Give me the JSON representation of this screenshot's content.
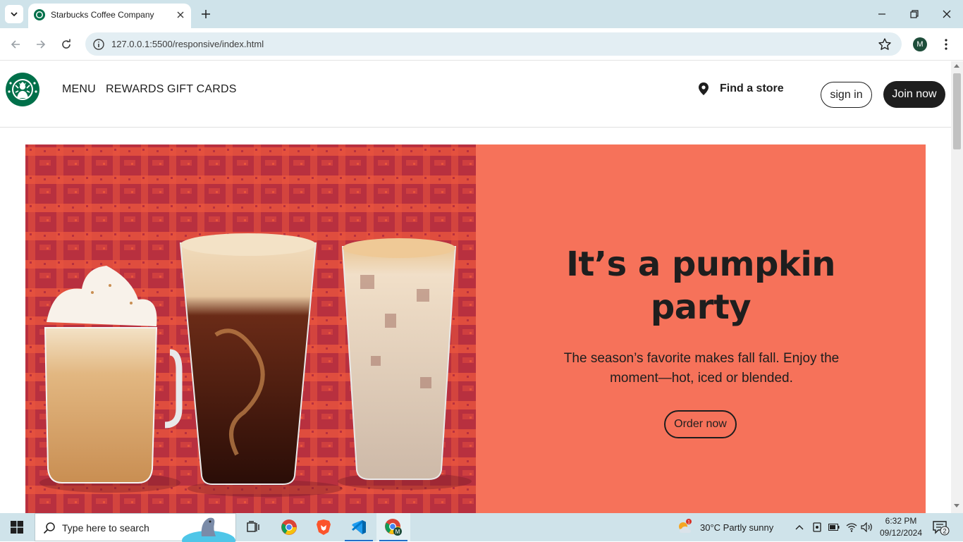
{
  "browser": {
    "tab_title": "Starbucks Coffee Company",
    "url": "127.0.0.1:5500/responsive/index.html",
    "profile_initial": "M"
  },
  "site": {
    "nav": [
      "MENU",
      "REWARDS",
      "GIFT CARDS"
    ],
    "find_store": "Find a store",
    "sign_in": "sign in",
    "join_now": "Join now"
  },
  "hero": {
    "title_line1": "It’s a pumpkin",
    "title_line2": "party",
    "subtitle": "The season’s favorite makes fall fall. Enjoy the moment—hot, iced or blended.",
    "cta": "Order now",
    "background_color": "#f6725a"
  },
  "taskbar": {
    "search_placeholder": "Type here to search",
    "weather": "30°C  Partly sunny",
    "time": "6:32 PM",
    "date": "09/12/2024",
    "notification_count": "2",
    "weather_badge": "1"
  }
}
